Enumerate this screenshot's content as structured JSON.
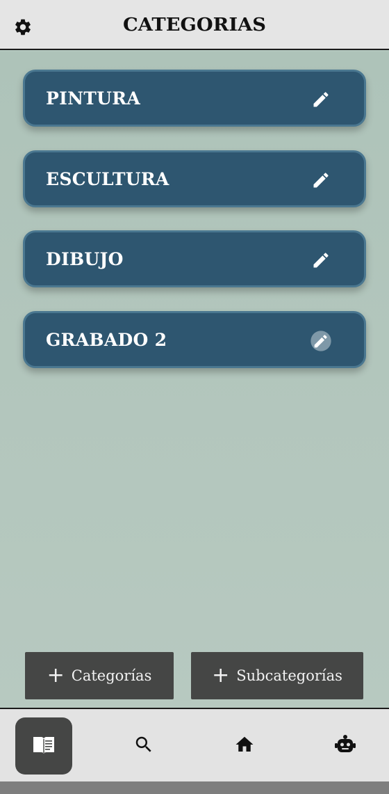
{
  "header": {
    "title": "CATEGORIAS",
    "settings_icon": "gear-icon"
  },
  "categories": [
    {
      "label": "PINTURA",
      "edit_icon": "pencil-icon"
    },
    {
      "label": "ESCULTURA",
      "edit_icon": "pencil-icon"
    },
    {
      "label": "DIBUJO",
      "edit_icon": "pencil-icon"
    },
    {
      "label": "GRABADO 2",
      "edit_icon": "pencil-icon"
    }
  ],
  "actions": {
    "add_category_label": "Categorías",
    "add_subcategory_label": "Subcategorías",
    "plus_symbol": "+"
  },
  "nav": [
    {
      "name": "book-icon",
      "active": true
    },
    {
      "name": "search-icon",
      "active": false
    },
    {
      "name": "home-icon",
      "active": false
    },
    {
      "name": "robot-icon",
      "active": false
    }
  ],
  "colors": {
    "card_bg": "#2e5670",
    "card_border": "#4a7790",
    "page_bg": "#b3c7be",
    "button_bg": "#454645",
    "topbar_bg": "#e5e5e5"
  }
}
